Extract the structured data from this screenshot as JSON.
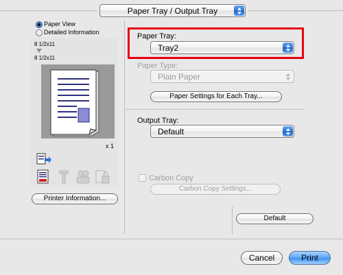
{
  "section_selector": {
    "value": "Paper Tray / Output Tray"
  },
  "view_mode": {
    "options": [
      {
        "label": "Paper View",
        "selected": true
      },
      {
        "label": "Detailed Information",
        "selected": false
      }
    ]
  },
  "preview": {
    "paper_size_top": "8 1/2x11",
    "paper_size_bottom": "8 1/2x11",
    "copies": "x 1"
  },
  "printer_info_button": "Printer Information...",
  "paper_tray": {
    "label": "Paper Tray:",
    "value": "Tray2"
  },
  "paper_type": {
    "label": "Paper Type:",
    "value": "Plain Paper",
    "enabled": false
  },
  "paper_settings_button": "Paper Settings for Each Tray...",
  "output_tray": {
    "label": "Output Tray:",
    "value": "Default"
  },
  "carbon_copy": {
    "label": "Carbon Copy",
    "checked": false,
    "enabled": false,
    "settings_button": "Carbon Copy Settings..."
  },
  "default_button": "Default",
  "cancel_button": "Cancel",
  "print_button": "Print",
  "colors": {
    "highlight": "#e60012",
    "accent_blue": "#2f74d6",
    "background": "#e8e8e8"
  }
}
